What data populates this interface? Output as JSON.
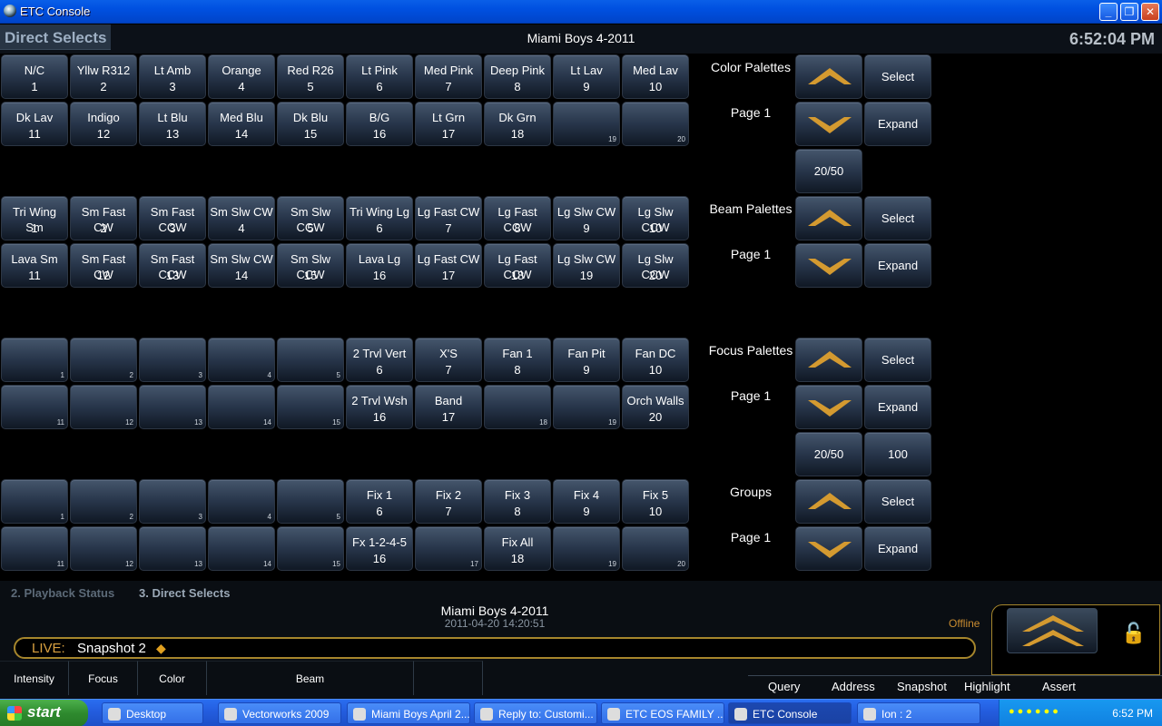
{
  "window": {
    "title": "ETC Console",
    "min": "_",
    "max": "❐",
    "close": "✕"
  },
  "header": {
    "tab": "Direct Selects",
    "show": "Miami Boys 4-2011",
    "clock": "6:52:04 PM"
  },
  "banks": [
    {
      "name": "color",
      "buttons": [
        {
          "l": "N/C",
          "n": "1"
        },
        {
          "l": "Yllw R312",
          "n": "2"
        },
        {
          "l": "Lt Amb",
          "n": "3"
        },
        {
          "l": "Orange",
          "n": "4"
        },
        {
          "l": "Red R26",
          "n": "5"
        },
        {
          "l": "Lt Pink",
          "n": "6"
        },
        {
          "l": "Med Pink",
          "n": "7"
        },
        {
          "l": "Deep Pink",
          "n": "8"
        },
        {
          "l": "Lt Lav",
          "n": "9"
        },
        {
          "l": "Med Lav",
          "n": "10"
        },
        {
          "l": "Dk Lav",
          "n": "11"
        },
        {
          "l": "Indigo",
          "n": "12"
        },
        {
          "l": "Lt Blu",
          "n": "13"
        },
        {
          "l": "Med Blu",
          "n": "14"
        },
        {
          "l": "Dk Blu",
          "n": "15"
        },
        {
          "l": "B/G",
          "n": "16"
        },
        {
          "l": "Lt Grn",
          "n": "17"
        },
        {
          "l": "Dk Grn",
          "n": "18"
        },
        {
          "s": "19"
        },
        {
          "s": "20"
        }
      ],
      "label": "Color Palettes",
      "page": "Page 1",
      "up": "",
      "down": "",
      "select": "Select",
      "expand": "Expand",
      "extra1": "20/50",
      "extra2": ""
    },
    {
      "name": "beam",
      "buttons": [
        {
          "l": "Tri Wing Sm",
          "n": "1"
        },
        {
          "l": "Sm Fast CW",
          "n": "2"
        },
        {
          "l": "Sm Fast CCW",
          "n": "3"
        },
        {
          "l": "Sm Slw CW",
          "n": "4"
        },
        {
          "l": "Sm Slw CCW",
          "n": "5"
        },
        {
          "l": "Tri Wing Lg",
          "n": "6"
        },
        {
          "l": "Lg Fast CW",
          "n": "7"
        },
        {
          "l": "Lg Fast CCW",
          "n": "8"
        },
        {
          "l": "Lg Slw CW",
          "n": "9"
        },
        {
          "l": "Lg Slw CCW",
          "n": "10"
        },
        {
          "l": "Lava Sm",
          "n": "11"
        },
        {
          "l": "Sm Fast CW",
          "n": "12"
        },
        {
          "l": "Sm Fast CCW",
          "n": "13"
        },
        {
          "l": "Sm Slw CW",
          "n": "14"
        },
        {
          "l": "Sm Slw CCW",
          "n": "15"
        },
        {
          "l": "Lava Lg",
          "n": "16"
        },
        {
          "l": "Lg Fast CW",
          "n": "17"
        },
        {
          "l": "Lg Fast CCW",
          "n": "18"
        },
        {
          "l": "Lg Slw CW",
          "n": "19"
        },
        {
          "l": "Lg Slw CCW",
          "n": "20"
        }
      ],
      "label": "Beam Palettes",
      "page": "Page 1",
      "select": "Select",
      "expand": "Expand",
      "extra1": "",
      "extra2": ""
    },
    {
      "name": "focus",
      "buttons": [
        {
          "s": "1"
        },
        {
          "s": "2"
        },
        {
          "s": "3"
        },
        {
          "s": "4"
        },
        {
          "s": "5"
        },
        {
          "l": "2 Trvl Vert",
          "n": "6"
        },
        {
          "l": "X'S",
          "n": "7"
        },
        {
          "l": "Fan 1",
          "n": "8"
        },
        {
          "l": "Fan Pit",
          "n": "9"
        },
        {
          "l": "Fan DC",
          "n": "10"
        },
        {
          "s": "11"
        },
        {
          "s": "12"
        },
        {
          "s": "13"
        },
        {
          "s": "14"
        },
        {
          "s": "15"
        },
        {
          "l": "2 Trvl Wsh",
          "n": "16"
        },
        {
          "l": "Band",
          "n": "17"
        },
        {
          "s": "18"
        },
        {
          "s": "19"
        },
        {
          "l": "Orch Walls",
          "n": "20"
        }
      ],
      "label": "Focus Palettes",
      "page": "Page 1",
      "select": "Select",
      "expand": "Expand",
      "extra1": "20/50",
      "extra2": "100"
    },
    {
      "name": "groups",
      "buttons": [
        {
          "s": "1"
        },
        {
          "s": "2"
        },
        {
          "s": "3"
        },
        {
          "s": "4"
        },
        {
          "s": "5"
        },
        {
          "l": "Fix 1",
          "n": "6"
        },
        {
          "l": "Fix 2",
          "n": "7"
        },
        {
          "l": "Fix 3",
          "n": "8"
        },
        {
          "l": "Fix 4",
          "n": "9"
        },
        {
          "l": "Fix 5",
          "n": "10"
        },
        {
          "s": "11"
        },
        {
          "s": "12"
        },
        {
          "s": "13"
        },
        {
          "s": "14"
        },
        {
          "s": "15"
        },
        {
          "l": "Fx 1-2-4-5",
          "n": "16"
        },
        {
          "s": "17"
        },
        {
          "l": "Fix All",
          "n": "18"
        },
        {
          "s": "19"
        },
        {
          "s": "20"
        }
      ],
      "label": "Groups",
      "page": "Page 1",
      "select": "Select",
      "expand": "Expand",
      "extra1": "",
      "extra2": ""
    }
  ],
  "bottom": {
    "tabs": [
      "2. Playback Status",
      "3. Direct Selects"
    ],
    "show": "Miami Boys 4-2011",
    "timestamp": "2011-04-20 14:20:51",
    "status": "Offline",
    "live_label": "LIVE:",
    "snapshot": "Snapshot 2",
    "categories": [
      "Intensity",
      "Focus",
      "Color",
      "Beam",
      ""
    ],
    "modes": [
      "Query",
      "Address",
      "Snapshot",
      "Highlight",
      "Assert"
    ]
  },
  "taskbar": {
    "start": "start",
    "tasks": [
      "Desktop",
      "Vectorworks 2009",
      "Miami Boys April 2...",
      "Reply to: Customi...",
      "ETC EOS FAMILY ...",
      "ETC Console",
      "Ion : 2"
    ],
    "clock": "6:52 PM"
  },
  "colors": {
    "accent_gold": "#a6862c",
    "arrow_gold": "#d49a30",
    "panel_blue": "#27354a",
    "taskbar_blue": "#245ee0"
  }
}
